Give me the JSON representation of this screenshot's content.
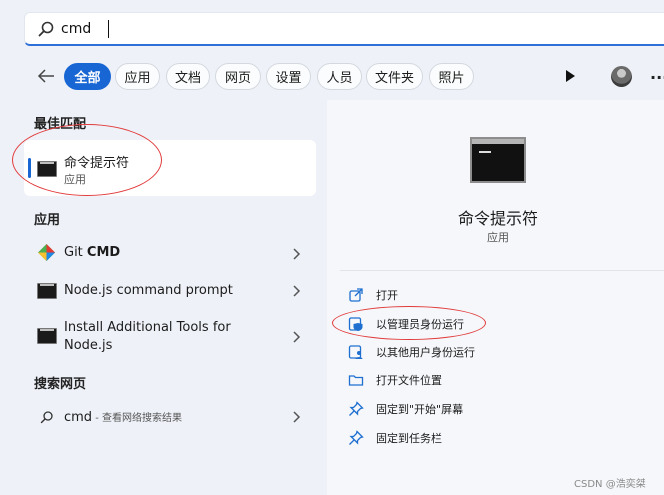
{
  "search": {
    "value": "cmd"
  },
  "filters": [
    "全部",
    "应用",
    "文档",
    "网页",
    "设置",
    "人员",
    "文件夹",
    "照片"
  ],
  "left": {
    "best_match_heading": "最佳匹配",
    "best_match": {
      "name": "命令提示符",
      "type": "应用"
    },
    "apps_heading": "应用",
    "apps": [
      {
        "name_plain": "Git ",
        "name_bold": "CMD"
      },
      {
        "name": "Node.js command prompt"
      },
      {
        "name_line1": "Install Additional Tools for",
        "name_line2": "Node.js"
      }
    ],
    "web_heading": "搜索网页",
    "web_result": {
      "query": "cmd",
      "hint": " - 查看网络搜索结果"
    }
  },
  "details": {
    "title": "命令提示符",
    "subtitle": "应用",
    "actions": [
      {
        "icon": "open-external-icon",
        "label": "打开"
      },
      {
        "icon": "shield-admin-icon",
        "label": "以管理员身份运行"
      },
      {
        "icon": "other-user-icon",
        "label": "以其他用户身份运行"
      },
      {
        "icon": "folder-icon",
        "label": "打开文件位置"
      },
      {
        "icon": "pin-icon",
        "label": "固定到\"开始\"屏幕"
      },
      {
        "icon": "pin-icon",
        "label": "固定到任务栏"
      }
    ]
  },
  "watermark": "CSDN @浩奕桀",
  "colors": {
    "accent": "#1866d4",
    "highlight_ring": "#e23a3a"
  }
}
